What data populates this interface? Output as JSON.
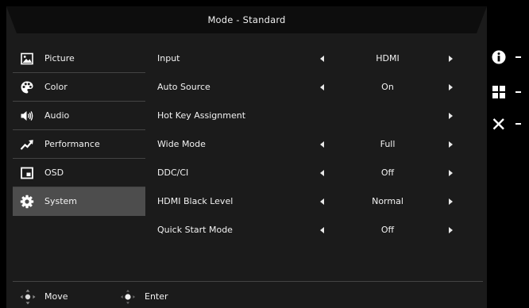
{
  "header": {
    "title": "Mode - Standard"
  },
  "sidebar": {
    "items": [
      {
        "label": "Picture",
        "icon": "picture-icon"
      },
      {
        "label": "Color",
        "icon": "palette-icon"
      },
      {
        "label": "Audio",
        "icon": "speaker-icon"
      },
      {
        "label": "Performance",
        "icon": "performance-arrow-icon"
      },
      {
        "label": "OSD",
        "icon": "osd-window-icon"
      },
      {
        "label": "System",
        "icon": "gear-icon",
        "selected": true
      }
    ]
  },
  "settings": {
    "rows": [
      {
        "label": "Input",
        "value": "HDMI"
      },
      {
        "label": "Auto Source",
        "value": "On"
      },
      {
        "label": "Hot Key Assignment",
        "value": ""
      },
      {
        "label": "Wide Mode",
        "value": "Full"
      },
      {
        "label": "DDC/CI",
        "value": "Off"
      },
      {
        "label": "HDMI Black Level",
        "value": "Normal"
      },
      {
        "label": "Quick Start Mode",
        "value": "Off"
      }
    ]
  },
  "footer": {
    "move_label": "Move",
    "enter_label": "Enter"
  },
  "hotkeys": [
    "info-icon",
    "grid-icon",
    "close-icon"
  ],
  "colors": {
    "panel": "#1b1b1b",
    "header": "#0d0d0d",
    "selected": "#4d4d4d",
    "divider": "#444444"
  }
}
